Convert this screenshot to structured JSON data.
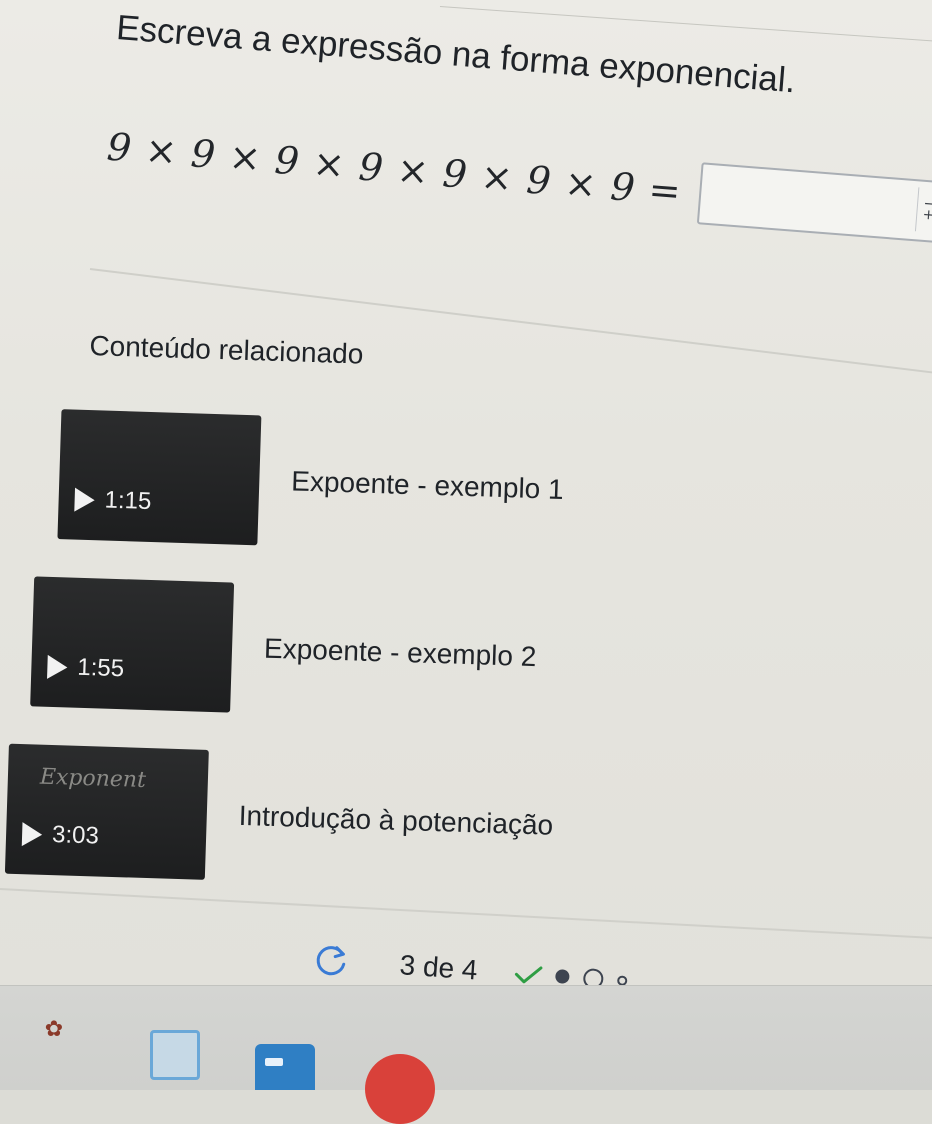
{
  "question": {
    "prompt": "Escreva a expressão na forma exponencial.",
    "expression": "9 × 9 × 9 × 9 × 9 × 9 × 9 =",
    "answer_value": "",
    "keypad_icon": "math-keypad-icon"
  },
  "related": {
    "title": "Conteúdo relacionado",
    "videos": [
      {
        "title": "Expoente - exemplo 1",
        "duration": "1:15",
        "caption": ""
      },
      {
        "title": "Expoente - exemplo 2",
        "duration": "1:55",
        "caption": ""
      },
      {
        "title": "Introdução à potenciação",
        "duration": "3:03",
        "caption": "Exponent"
      }
    ]
  },
  "pagination": {
    "refresh_icon": "refresh-icon",
    "label": "3 de 4",
    "progress": [
      "check",
      "current",
      "empty",
      "empty-small"
    ]
  },
  "colors": {
    "text": "#1f2328",
    "thumbnail": "#232425",
    "accent_check": "#2f9e44"
  }
}
